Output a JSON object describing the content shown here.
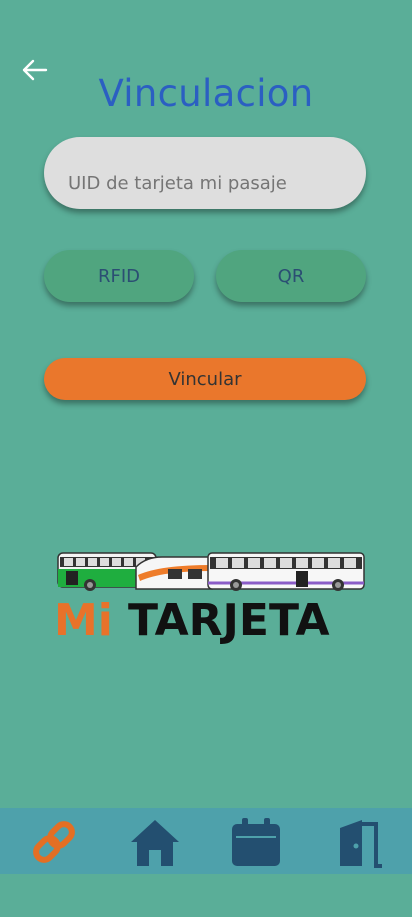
{
  "header": {
    "title": "Vinculacion"
  },
  "form": {
    "uid_placeholder": "UID de tarjeta mi pasaje",
    "rfid_label": "RFID",
    "qr_label": "QR",
    "submit_label": "Vincular"
  },
  "logo": {
    "mi": "Mi",
    "tarjeta": "TARJETA"
  },
  "bottom_nav": {
    "items": [
      "link-icon",
      "home-icon",
      "calendar-icon",
      "exit-door-icon"
    ]
  },
  "colors": {
    "background": "#5aae98",
    "title": "#2b5fc2",
    "button_green": "#50a57f",
    "button_orange": "#ea772c",
    "nav_bar": "#4ea1ab",
    "nav_active": "#e36f24",
    "nav_icon": "#234f70"
  }
}
